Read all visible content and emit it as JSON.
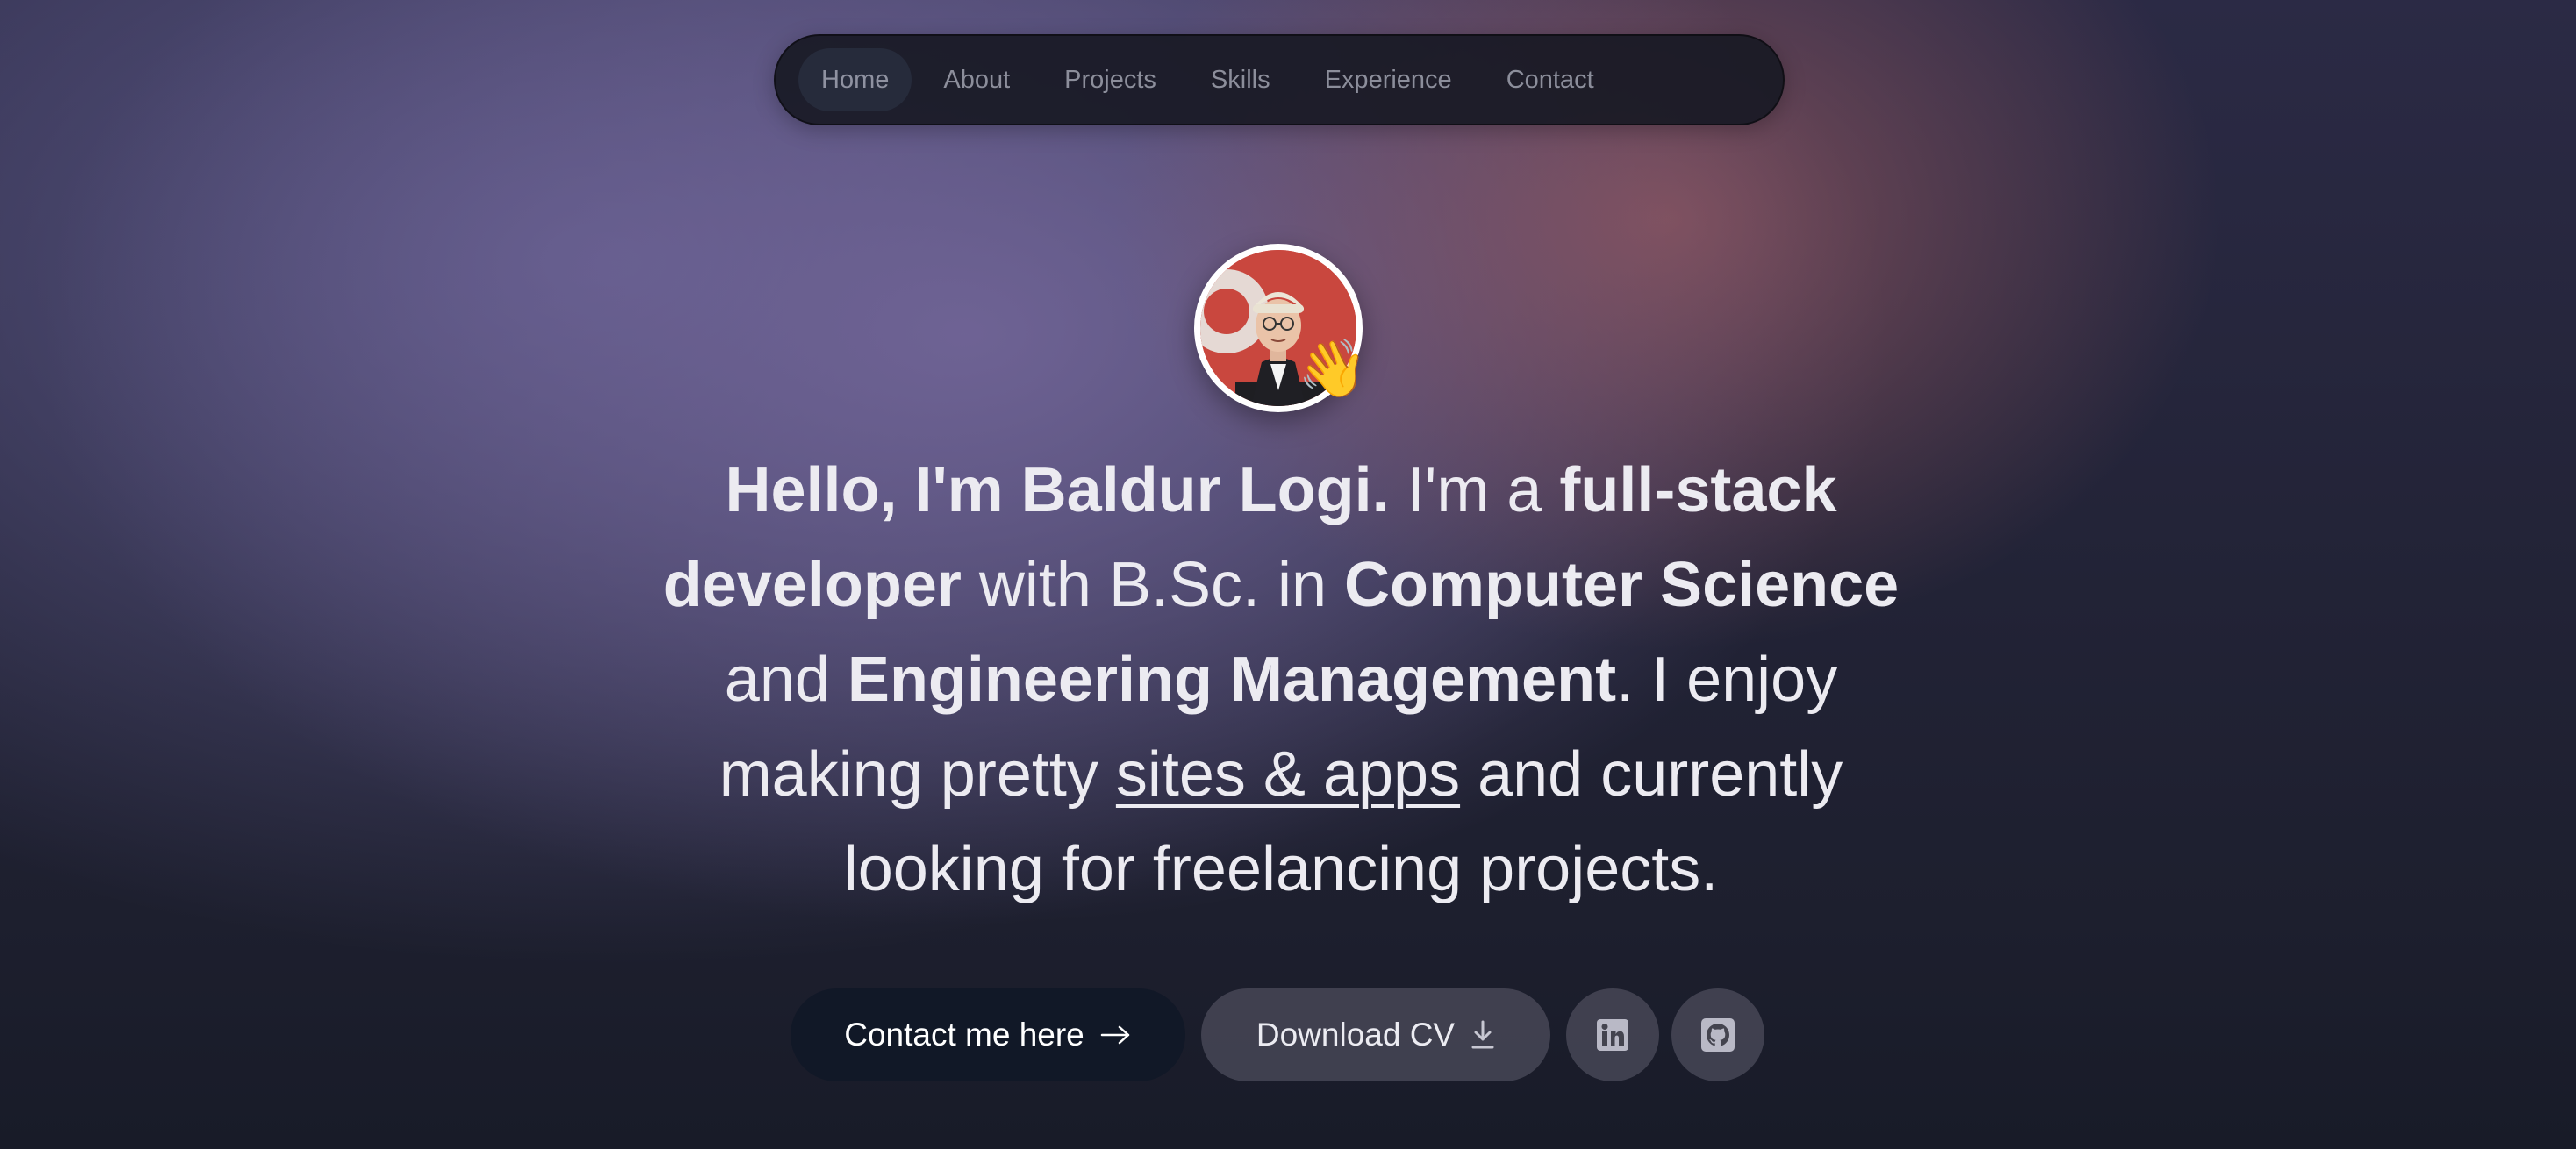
{
  "nav": {
    "items": [
      {
        "label": "Home",
        "active": true
      },
      {
        "label": "About"
      },
      {
        "label": "Projects"
      },
      {
        "label": "Skills"
      },
      {
        "label": "Experience"
      },
      {
        "label": "Contact"
      }
    ]
  },
  "hero": {
    "avatar_icon": "profile-photo",
    "wave_emoji": "👋",
    "headline": {
      "p1": "Hello, I'm Baldur Logi.",
      "p2": " I'm a ",
      "p3": "full-stack developer",
      "p4": " with B.Sc. in ",
      "p5": "Computer Science",
      "p6": " and ",
      "p7": "Engineering Management",
      "p8": ". I enjoy making pretty ",
      "p9": "sites & apps",
      "p10": " and currently looking for freelancing projects."
    }
  },
  "actions": {
    "contact_label": "Contact me here",
    "cv_label": "Download CV",
    "linkedin_icon": "linkedin-icon",
    "github_icon": "github-icon"
  },
  "colors": {
    "dark_button": "#111827",
    "nav_bg": "#181924",
    "text": "#ecebf1"
  }
}
